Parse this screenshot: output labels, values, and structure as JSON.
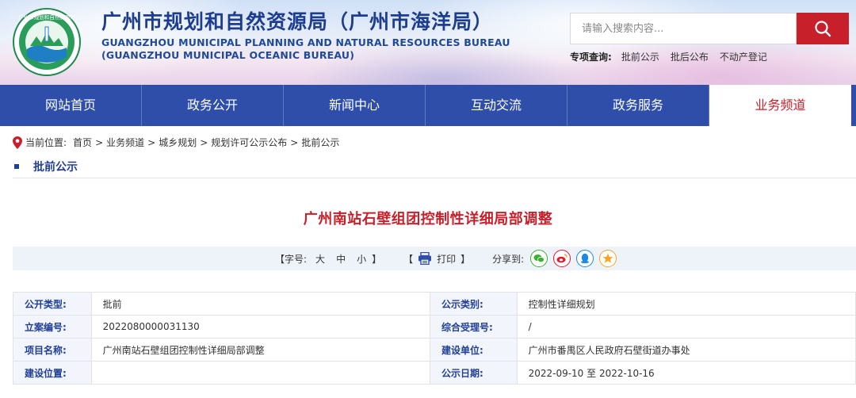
{
  "header": {
    "title_cn": "广州市规划和自然资源局（广州市海洋局）",
    "title_en_line1": "GUANGZHOU MUNICIPAL PLANNING AND NATURAL RESOURCES BUREAU",
    "title_en_line2": "(GUANGZHOU MUNICIPAL OCEANIC BUREAU)",
    "logo_text": "广州市规划和自然资源局"
  },
  "search": {
    "placeholder": "请输入搜索内容...",
    "button_icon": "search-icon"
  },
  "quick_links": {
    "label": "专项查询:",
    "items": [
      "批前公示",
      "批后公布",
      "不动产登记"
    ]
  },
  "nav": {
    "items": [
      "网站首页",
      "政务公开",
      "新闻中心",
      "互动交流",
      "政务服务",
      "业务频道"
    ],
    "active": "业务频道"
  },
  "breadcrumb": {
    "label": "当前位置:",
    "items": [
      "首页",
      "业务频道",
      "城乡规划",
      "规划许可公示公布",
      "批前公示"
    ]
  },
  "section": {
    "title": "批前公示"
  },
  "article": {
    "title": "广州南站石壁组团控制性详细局部调整"
  },
  "tools": {
    "font_size_label": "【字号:",
    "sizes": [
      "大",
      "中",
      "小"
    ],
    "font_size_end": "】",
    "print_open": "【",
    "print_label": "打印",
    "print_close": "】",
    "share_label": "分享到:",
    "share_icons": [
      "wechat-icon",
      "weibo-icon",
      "qq-icon",
      "qzone-icon"
    ]
  },
  "info": {
    "rows": [
      {
        "k1": "公开类型:",
        "v1": "批前",
        "k2": "公示类别:",
        "v2": "控制性详细规划"
      },
      {
        "k1": "立案编号:",
        "v1": "2022080000031130",
        "k2": "综合受理号:",
        "v2": "/"
      },
      {
        "k1": "项目名称:",
        "v1": "广州南站石壁组团控制性详细局部调整",
        "k2": "建设单位:",
        "v2": "广州市番禺区人民政府石壁街道办事处"
      },
      {
        "k1": "建设位置:",
        "v1": "",
        "k2": "公示日期:",
        "v2": "2022-09-10 至 2022-10-16"
      }
    ]
  },
  "colors": {
    "nav_bg": "#2e4ea9",
    "accent_red": "#c8202a",
    "label_blue": "#1f3f96"
  }
}
